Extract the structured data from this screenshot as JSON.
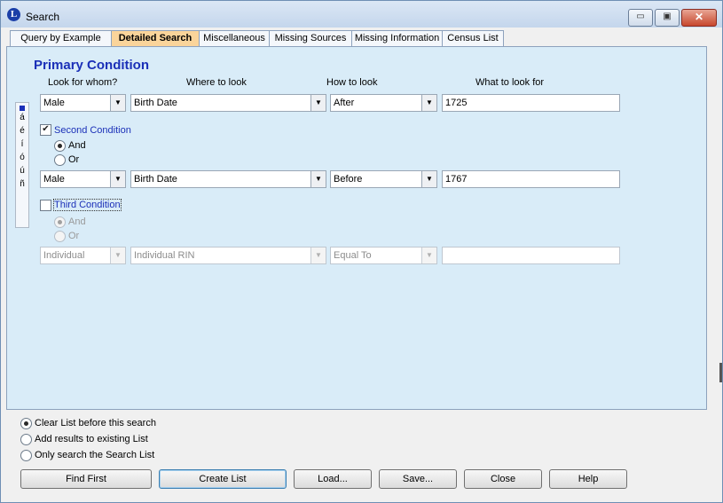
{
  "window": {
    "title": "Search",
    "app_icon_letter": "L",
    "controls": {
      "minimize": "▭",
      "maximize": "▣",
      "close": "✕"
    }
  },
  "tabs": [
    {
      "label": "Query by Example",
      "active": false
    },
    {
      "label": "Detailed Search",
      "active": true
    },
    {
      "label": "Miscellaneous",
      "active": false
    },
    {
      "label": "Missing Sources",
      "active": false
    },
    {
      "label": "Missing Information",
      "active": false
    },
    {
      "label": "Census List",
      "active": false
    }
  ],
  "primary": {
    "heading": "Primary Condition",
    "headers": {
      "whom": "Look for whom?",
      "where": "Where to look",
      "how": "How to look",
      "what": "What to look for"
    },
    "whom": "Male",
    "where": "Birth Date",
    "how": "After",
    "what": "1725"
  },
  "second": {
    "label": "Second Condition",
    "checked": true,
    "and_label": "And",
    "or_label": "Or",
    "and_selected": true,
    "whom": "Male",
    "where": "Birth Date",
    "how": "Before",
    "what": "1767"
  },
  "third": {
    "label": "Third Condition",
    "checked": false,
    "and_label": "And",
    "or_label": "Or",
    "and_selected": true,
    "whom": "Individual",
    "where": "Individual RIN",
    "how": "Equal To",
    "what": ""
  },
  "special_chars": [
    "á",
    "é",
    "í",
    "ó",
    "ú",
    "ñ"
  ],
  "list_options": [
    {
      "label": "Clear List before this search",
      "selected": true
    },
    {
      "label": "Add results to existing List",
      "selected": false
    },
    {
      "label": "Only search the Search List",
      "selected": false
    }
  ],
  "buttons": {
    "find_first": "Find First",
    "create_list": "Create List",
    "load": "Load...",
    "save": "Save...",
    "close": "Close",
    "help": "Help"
  },
  "icons": {
    "dropdown": "chevron-down-icon",
    "checkmark": "check-icon",
    "app": "legacy-app-icon"
  }
}
